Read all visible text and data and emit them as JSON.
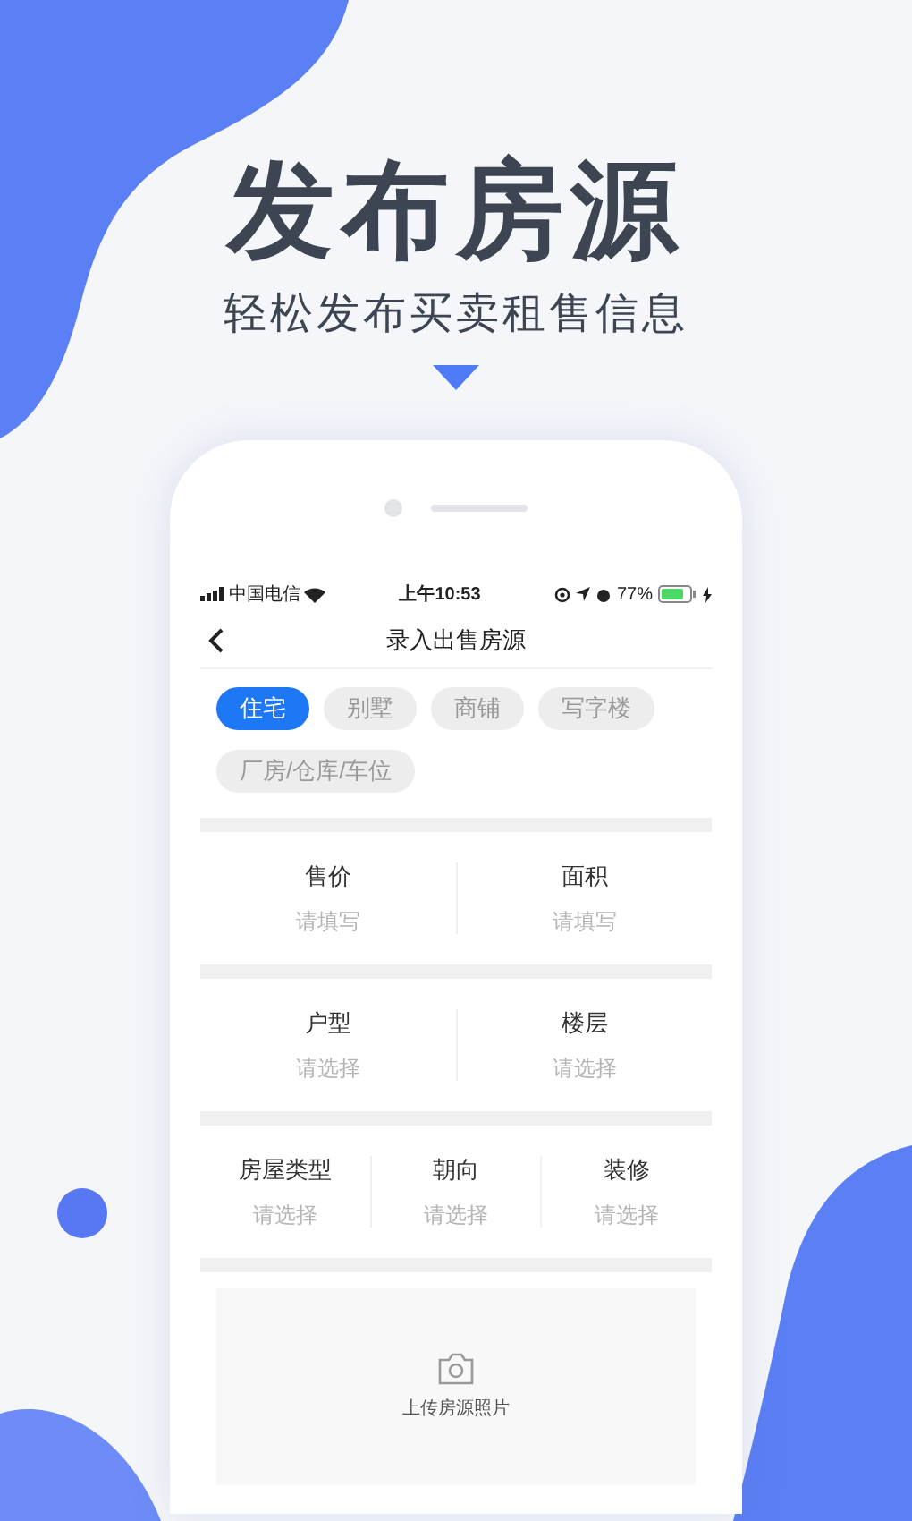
{
  "hero": {
    "title": "发布房源",
    "subtitle": "轻松发布买卖租售信息"
  },
  "status_bar": {
    "carrier": "中国电信",
    "time": "上午10:53",
    "battery": "77%"
  },
  "nav": {
    "title": "录入出售房源"
  },
  "tags": [
    {
      "label": "住宅",
      "selected": true
    },
    {
      "label": "别墅",
      "selected": false
    },
    {
      "label": "商铺",
      "selected": false
    },
    {
      "label": "写字楼",
      "selected": false
    },
    {
      "label": "厂房/仓库/车位",
      "selected": false
    }
  ],
  "sections": [
    {
      "fields": [
        {
          "label": "售价",
          "placeholder": "请填写"
        },
        {
          "label": "面积",
          "placeholder": "请填写"
        }
      ]
    },
    {
      "fields": [
        {
          "label": "户型",
          "placeholder": "请选择"
        },
        {
          "label": "楼层",
          "placeholder": "请选择"
        }
      ]
    },
    {
      "fields": [
        {
          "label": "房屋类型",
          "placeholder": "请选择"
        },
        {
          "label": "朝向",
          "placeholder": "请选择"
        },
        {
          "label": "装修",
          "placeholder": "请选择"
        }
      ]
    }
  ],
  "upload": {
    "label": "上传房源照片"
  }
}
